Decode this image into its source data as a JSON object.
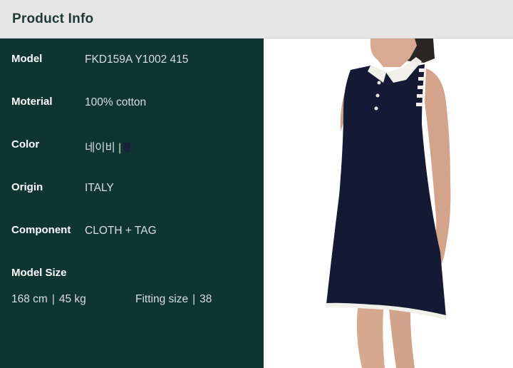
{
  "header": {
    "title": "Product Info"
  },
  "details": [
    {
      "label": "Model",
      "value": "FKD159A Y1002 415"
    },
    {
      "label": "Moterial",
      "value": "100% cotton"
    },
    {
      "label": "Color",
      "value": "네이비 |"
    },
    {
      "label": "Origin",
      "value": "ITALY"
    },
    {
      "label": "Component",
      "value": "CLOTH + TAG"
    }
  ],
  "color_swatch": "#1a1f3a",
  "model_size": {
    "label": "Model Size",
    "height": "168 cm",
    "weight": "45 kg",
    "fitting_label": "Fitting size",
    "fitting_value": "38",
    "separator": "|"
  },
  "photo": {
    "icon": "sleeveless-polo-dress-photo",
    "dress_color": "#141a33",
    "trim_color": "#f2f0ea"
  }
}
